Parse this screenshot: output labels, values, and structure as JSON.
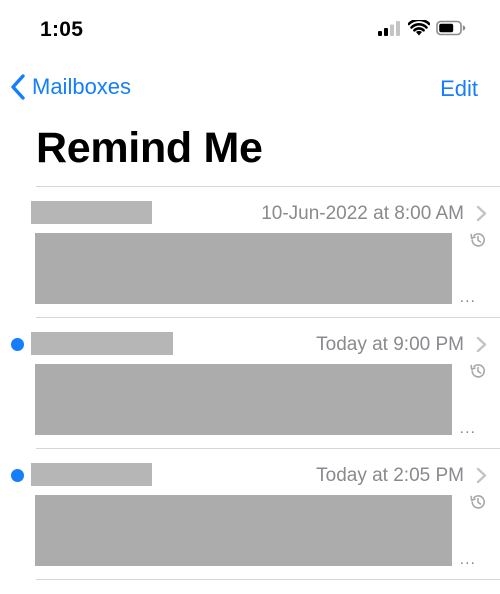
{
  "status_bar": {
    "time": "1:05",
    "icons": [
      "cellular-signal-icon",
      "wifi-icon",
      "battery-icon"
    ]
  },
  "nav": {
    "back_label": "Mailboxes",
    "edit_label": "Edit"
  },
  "title": "Remind Me",
  "colors": {
    "accent": "#147efb",
    "secondary_text": "#8a8a8e",
    "redaction": "#acacac"
  },
  "messages": [
    {
      "date": "10-Jun-2022 at 8:00 AM",
      "unread": false,
      "sender_redacted": true,
      "preview_redacted": true,
      "more": "..."
    },
    {
      "date": "Today at 9:00 PM",
      "unread": true,
      "sender_redacted": true,
      "preview_redacted": true,
      "more": "..."
    },
    {
      "date": "Today at 2:05 PM",
      "unread": true,
      "sender_redacted": true,
      "preview_redacted": true,
      "more": "..."
    }
  ]
}
